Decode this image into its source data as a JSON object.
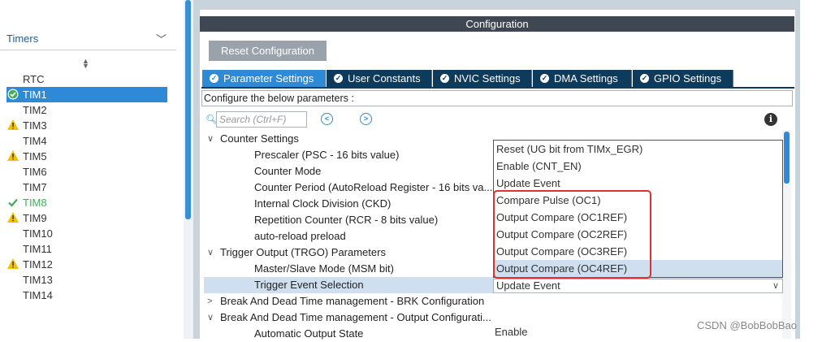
{
  "left": {
    "section": "Timers",
    "items": [
      {
        "label": "RTC",
        "status": "none"
      },
      {
        "label": "TIM1",
        "status": "ok-selected"
      },
      {
        "label": "TIM2",
        "status": "none"
      },
      {
        "label": "TIM3",
        "status": "warning"
      },
      {
        "label": "TIM4",
        "status": "none"
      },
      {
        "label": "TIM5",
        "status": "warning"
      },
      {
        "label": "TIM6",
        "status": "none"
      },
      {
        "label": "TIM7",
        "status": "none"
      },
      {
        "label": "TIM8",
        "status": "ok"
      },
      {
        "label": "TIM9",
        "status": "warning"
      },
      {
        "label": "TIM10",
        "status": "none"
      },
      {
        "label": "TIM11",
        "status": "none"
      },
      {
        "label": "TIM12",
        "status": "warning"
      },
      {
        "label": "TIM13",
        "status": "none"
      },
      {
        "label": "TIM14",
        "status": "none"
      }
    ]
  },
  "header": {
    "title": "Configuration",
    "reset_label": "Reset Configuration"
  },
  "tabs": [
    {
      "label": "Parameter Settings",
      "active": true
    },
    {
      "label": "User Constants",
      "active": false
    },
    {
      "label": "NVIC Settings",
      "active": false
    },
    {
      "label": "DMA Settings",
      "active": false
    },
    {
      "label": "GPIO Settings",
      "active": false
    }
  ],
  "configure_text": "Configure the below parameters :",
  "search_placeholder": "Search (Ctrl+F)",
  "tree": [
    {
      "kind": "group",
      "label": "Counter Settings",
      "expanded": true
    },
    {
      "kind": "param",
      "label": "Prescaler (PSC - 16 bits value)"
    },
    {
      "kind": "param",
      "label": "Counter Mode"
    },
    {
      "kind": "param",
      "label": "Counter Period (AutoReload Register - 16 bits va..."
    },
    {
      "kind": "param",
      "label": "Internal Clock Division (CKD)"
    },
    {
      "kind": "param",
      "label": "Repetition Counter (RCR - 8 bits value)"
    },
    {
      "kind": "param",
      "label": "auto-reload preload"
    },
    {
      "kind": "group",
      "label": "Trigger Output (TRGO) Parameters",
      "expanded": true
    },
    {
      "kind": "param",
      "label": "Master/Slave Mode (MSM bit)"
    },
    {
      "kind": "param",
      "label": "Trigger Event Selection",
      "selected": true
    },
    {
      "kind": "group",
      "label": "Break And Dead Time management - BRK Configuration",
      "expanded": false
    },
    {
      "kind": "group",
      "label": "Break And Dead Time management - Output Configurati...",
      "expanded": true
    },
    {
      "kind": "param",
      "label": "Automatic Output State",
      "value": "Enable"
    }
  ],
  "dropdown": {
    "options": [
      "Reset (UG bit from TIMx_EGR)",
      "Enable (CNT_EN)",
      "Update Event",
      "Compare Pulse (OC1)",
      "Output Compare (OC1REF)",
      "Output Compare (OC2REF)",
      "Output Compare (OC3REF)",
      "Output Compare (OC4REF)"
    ],
    "highlighted": "Output Compare (OC4REF)",
    "current_value": "Update Event"
  },
  "watermark": "CSDN @BobBobBao",
  "colors": {
    "accent": "#2e8ad6",
    "tab_dark": "#0e3a5c",
    "header_bar": "#3f4852",
    "warning": "#f2c200",
    "ok": "#3fae5a",
    "highlight_box": "#e03030"
  }
}
